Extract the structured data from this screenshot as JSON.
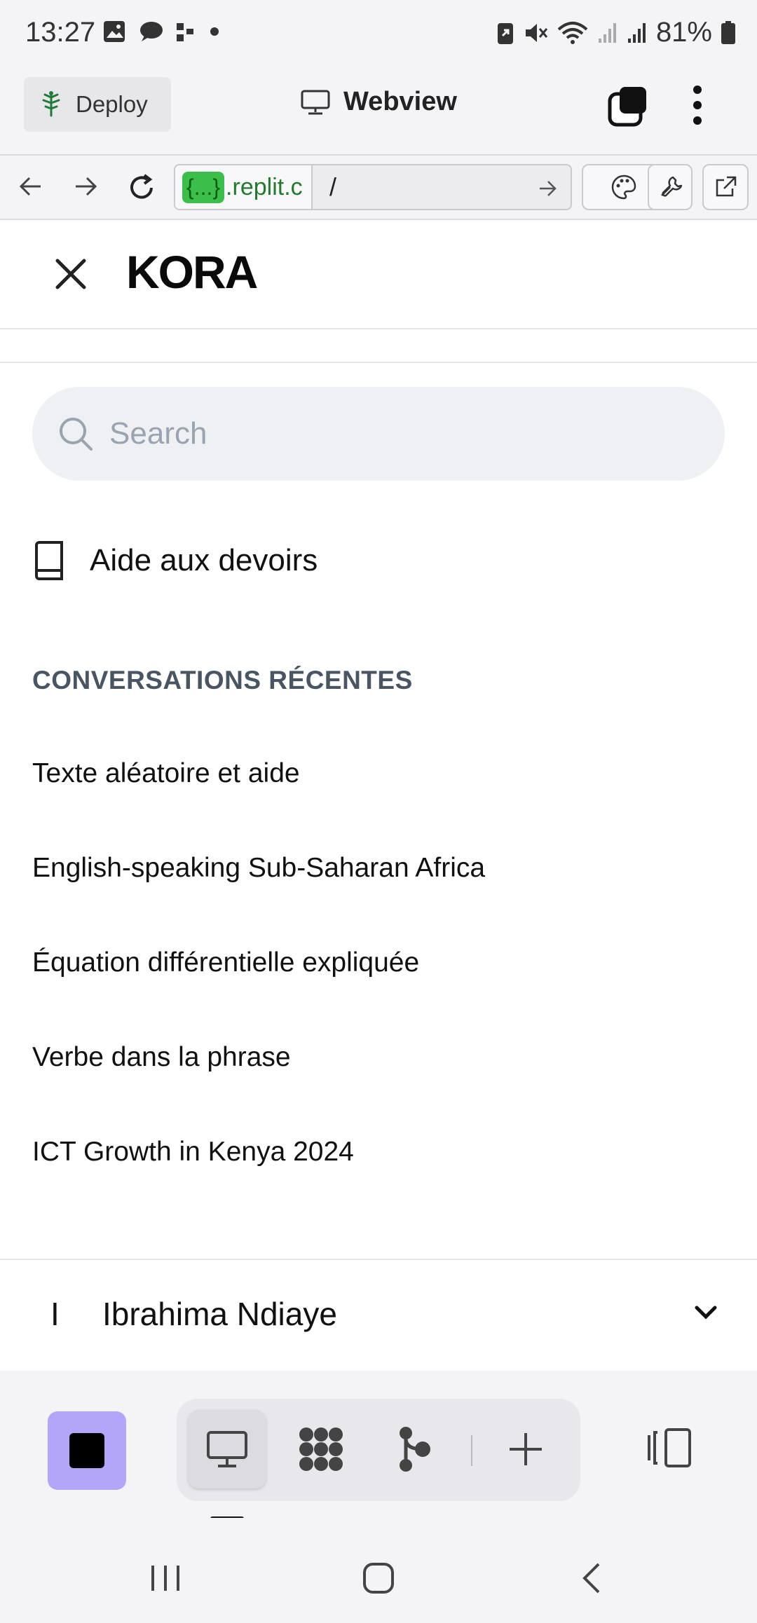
{
  "status_bar": {
    "time": "13:27",
    "battery_percent": "81%",
    "left_icons": [
      "gallery-icon",
      "chat-bubble-icon",
      "app-notification-icon",
      "dot-icon"
    ],
    "right_icons": [
      "battery-saver-icon",
      "mute-icon",
      "wifi-icon",
      "signal-icon",
      "signal-icon",
      "battery-icon"
    ]
  },
  "top_bar": {
    "deploy_label": "Deploy",
    "title": "Webview"
  },
  "url_bar": {
    "host_badge": "{...}",
    "host_text": ".replit.c",
    "path": "/"
  },
  "app": {
    "brand": "KORA",
    "search_placeholder": "Search",
    "homework_label": "Aide aux devoirs",
    "recent_heading": "CONVERSATIONS RÉCENTES",
    "conversations": [
      "Texte aléatoire et aide",
      "English-speaking Sub-Saharan Africa",
      "Équation différentielle expliquée",
      "Verbe dans la phrase",
      "ICT Growth in Kenya 2024"
    ],
    "user": {
      "initial": "I",
      "name": "Ibrahima Ndiaye"
    }
  },
  "colors": {
    "stop_button": "#b3a6f8",
    "url_badge": "#3bbf4a",
    "heading": "#4a5563"
  }
}
